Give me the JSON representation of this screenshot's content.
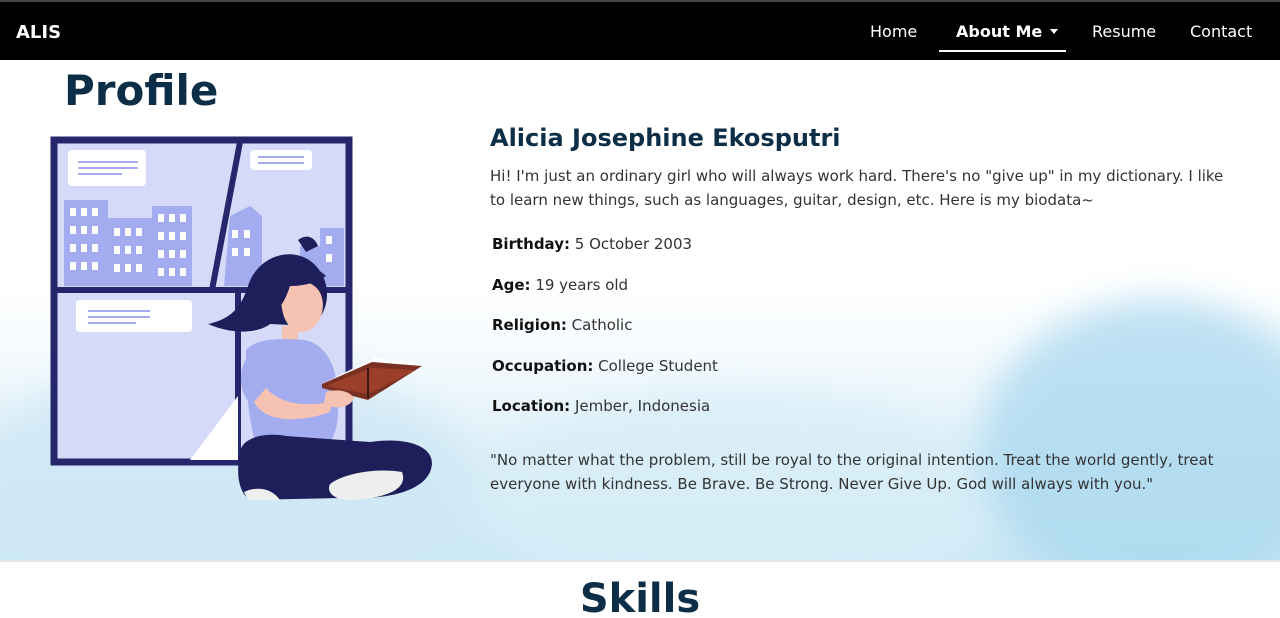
{
  "nav": {
    "brand": "ALIS",
    "home": "Home",
    "about": "About Me",
    "resume": "Resume",
    "contact": "Contact"
  },
  "profile": {
    "section_title": "Profile",
    "name": "Alicia Josephine Ekosputri",
    "bio": "Hi! I'm just an ordinary girl who will always work hard. There's no \"give up\" in my dictionary. I like to learn new things, such as languages, guitar, design, etc. Here is my biodata~",
    "facts": [
      {
        "label": "Birthday:",
        "value": "5 October 2003"
      },
      {
        "label": "Age:",
        "value": "19 years old"
      },
      {
        "label": "Religion:",
        "value": "Catholic"
      },
      {
        "label": "Occupation:",
        "value": "College Student"
      },
      {
        "label": "Location:",
        "value": "Jember, Indonesia"
      }
    ],
    "quote": "\"No matter what the problem, still be royal to the original intention. Treat the world gently, treat everyone with kindness. Be Brave. Be Strong. Never Give Up. God will always with you.\""
  },
  "skills": {
    "title": "Skills"
  },
  "colors": {
    "navbar_bg": "#000000",
    "heading": "#0d2e47",
    "illustration_dark": "#25266b",
    "illustration_light": "#d6daf9",
    "illustration_accent": "#a4acf0"
  },
  "icons": {
    "dropdown": "caret-down-icon",
    "illustration": "girl-reading-book-illustration"
  }
}
